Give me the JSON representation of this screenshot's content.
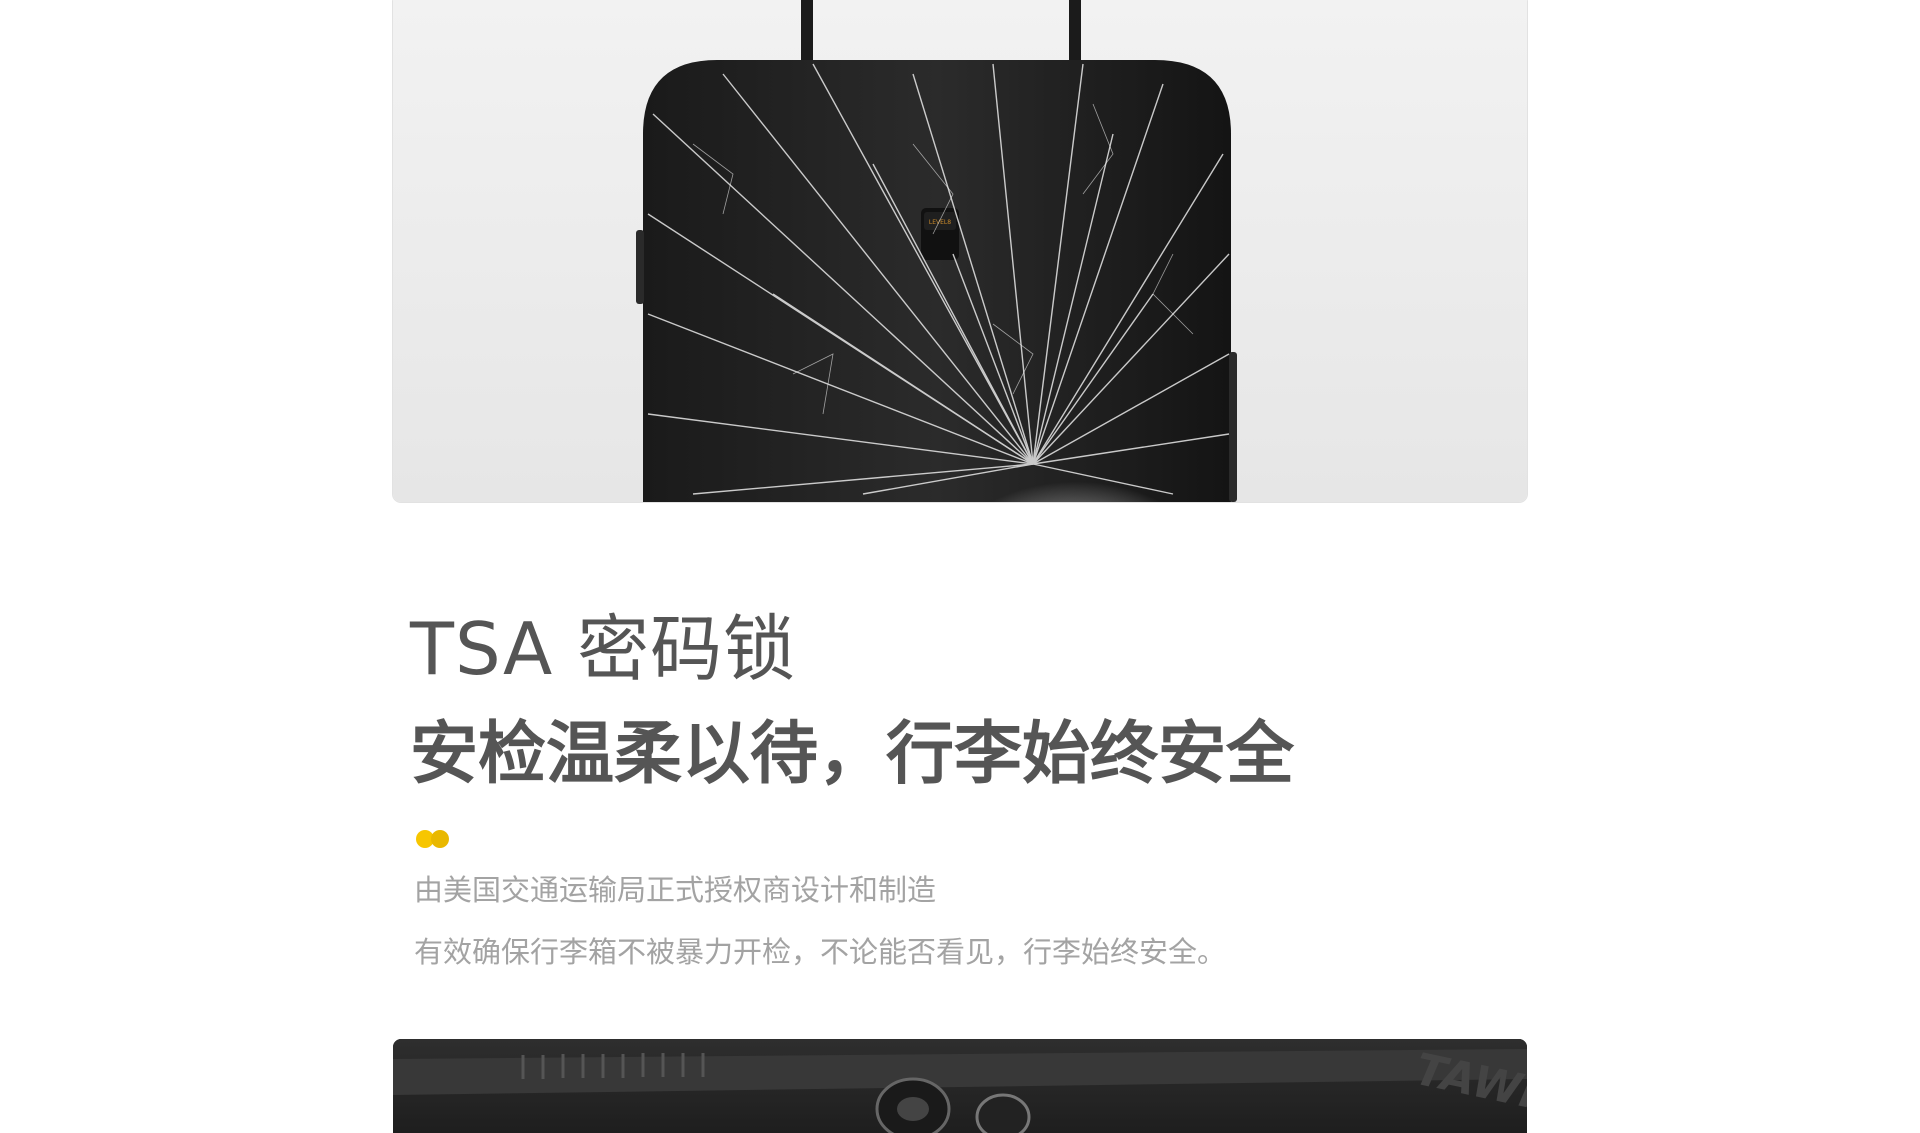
{
  "hero": {
    "product_image": "suitcase-cracked-glass-image",
    "brand_text": "LEVEL8"
  },
  "section": {
    "title": "TSA 密码锁",
    "subtitle": "安检温柔以待，行李始终安全",
    "description_line1": "由美国交通运输局正式授权商设计和制造",
    "description_line2": "有效确保行李箱不被暴力开检，不论能否看见，行李始终安全。"
  },
  "colors": {
    "accent_yellow": "#f7c600",
    "accent_yellow_dark": "#e9b800",
    "title_gray": "#555555",
    "desc_gray": "#a3a3a3"
  },
  "bottom": {
    "product_image": "tsa-lock-zipper-closeup-image"
  }
}
